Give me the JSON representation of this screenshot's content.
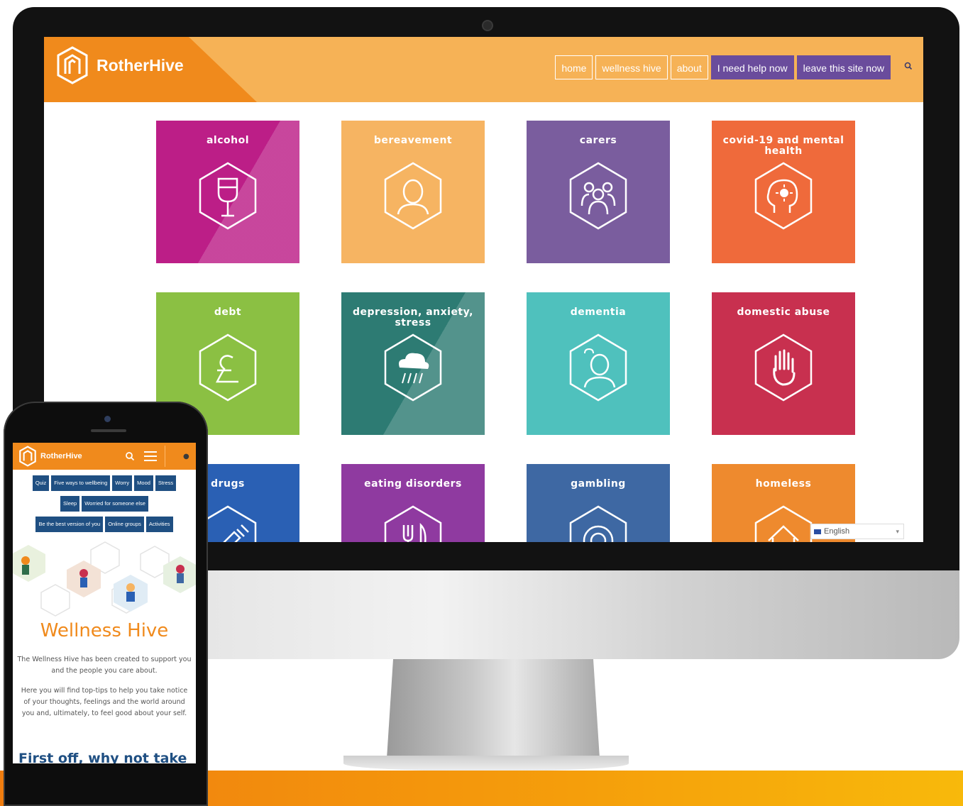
{
  "desktop": {
    "brand": "RotherHive",
    "nav": [
      {
        "label": "home",
        "style": "outline"
      },
      {
        "label": "wellness hive",
        "style": "outline"
      },
      {
        "label": "about",
        "style": "outline"
      },
      {
        "label": "I need help now",
        "style": "filled"
      },
      {
        "label": "leave this site now",
        "style": "filled"
      }
    ],
    "tiles": [
      {
        "label": "alcohol",
        "color": "#bc1e87",
        "icon": "wine-glass-icon"
      },
      {
        "label": "bereavement",
        "color": "#f6b462",
        "icon": "grieving-person-icon"
      },
      {
        "label": "carers",
        "color": "#7a5d9e",
        "icon": "group-of-people-icon"
      },
      {
        "label": "covid-19 and mental health",
        "color": "#ef6a3b",
        "icon": "head-with-virus-icon"
      },
      {
        "label": "debt",
        "color": "#8bc043",
        "icon": "pound-sign-icon"
      },
      {
        "label": "depression, anxiety, stress",
        "color": "#2d7b73",
        "icon": "rain-cloud-icon"
      },
      {
        "label": "dementia",
        "color": "#4fc1bd",
        "icon": "confused-person-icon"
      },
      {
        "label": "domestic abuse",
        "color": "#c8304f",
        "icon": "raised-hand-icon"
      },
      {
        "label": "drugs",
        "color": "#2a60b4",
        "icon": "syringe-icon"
      },
      {
        "label": "eating disorders",
        "color": "#8f3aa0",
        "icon": "knife-and-fork-icon"
      },
      {
        "label": "gambling",
        "color": "#3e68a3",
        "icon": "roulette-chip-icon"
      },
      {
        "label": "homeless",
        "color": "#ee8a2e",
        "icon": "house-icon"
      }
    ],
    "language": "English"
  },
  "phone": {
    "brand": "RotherHive",
    "chips_rows": [
      [
        "Quiz",
        "Five ways to wellbeing",
        "Worry",
        "Mood",
        "Stress"
      ],
      [
        "Sleep",
        "Worried for someone else"
      ],
      [
        "Be the best version of you",
        "Online groups",
        "Activities"
      ]
    ],
    "title": "Wellness Hive",
    "para1": "The Wellness Hive has been created to support you and the people you care about.",
    "para2": "Here you will find top-tips to help you take notice of your thoughts, feelings and the world around you and, ultimately, to feel good about your self.",
    "subheading": "First off, why not take"
  },
  "colors": {
    "header_orange": "#f6b256",
    "brand_orange": "#f08a1c",
    "help_purple": "#6a4c9c",
    "chip_blue": "#1f4f82"
  }
}
